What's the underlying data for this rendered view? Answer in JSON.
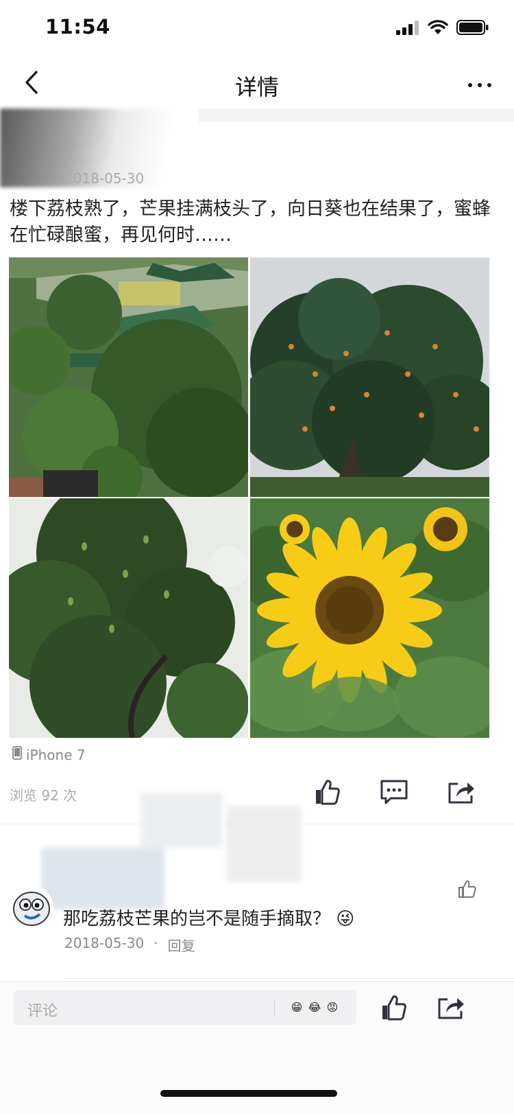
{
  "status_bar": {
    "time": "11:54"
  },
  "nav": {
    "title": "详情"
  },
  "post": {
    "date": "2018-05-30",
    "text": "楼下荔枝熟了，芒果挂满枝头了，向日葵也在结果了，蜜蜂在忙碌酿蜜，再见何时……",
    "photos": [
      "aerial-garden-trees",
      "lychee-tree",
      "mango-tree",
      "sunflower"
    ]
  },
  "device": {
    "label": "iPhone 7"
  },
  "stats": {
    "views": "浏览 92 次"
  },
  "comment": {
    "text": "那吃荔枝芒果的岂不是随手摘取？",
    "emoji": "😜",
    "date": "2018-05-30",
    "dot": "·",
    "reply": "回复"
  },
  "bottom_bar": {
    "placeholder": "评论",
    "emojis": [
      "😁",
      "😂",
      "😡"
    ]
  },
  "colors": {
    "icon": "#2f3440",
    "sunflower": "#f7cc16",
    "leaf": "#3f6b33"
  }
}
